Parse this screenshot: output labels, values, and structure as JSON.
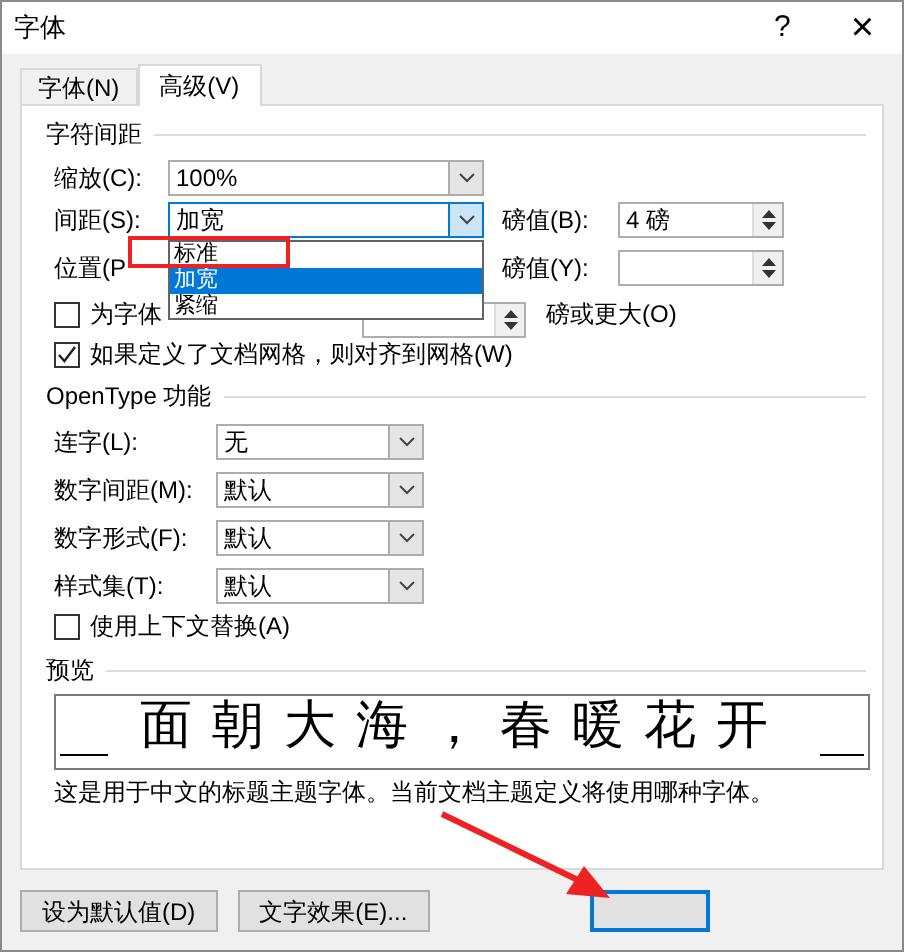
{
  "window": {
    "title": "字体",
    "help": "?",
    "close": "×"
  },
  "tabs": [
    {
      "label": "字体(N)",
      "selected": false
    },
    {
      "label": "高级(V)",
      "selected": true
    }
  ],
  "character_spacing": {
    "heading": "字符间距",
    "scale": {
      "label": "缩放(C):",
      "value": "100%"
    },
    "spacing": {
      "label": "间距(S):",
      "value": "加宽",
      "open": true,
      "by_label": "磅值(B):",
      "by_value": "4 磅"
    },
    "spacing_options": [
      {
        "label": "标准",
        "selected": false
      },
      {
        "label": "加宽",
        "selected": true
      },
      {
        "label": "紧缩",
        "selected": false
      }
    ],
    "position": {
      "label": "位置(P",
      "by_label": "磅值(Y):"
    },
    "kerning": {
      "label": "为字体",
      "checked": false,
      "suffix": "磅或更大(O)"
    },
    "snap_to_grid": {
      "label": "如果定义了文档网格，则对齐到网格(W)",
      "checked": true
    }
  },
  "opentype": {
    "heading": "OpenType 功能",
    "rows": [
      {
        "label": "连字(L):",
        "value": "无"
      },
      {
        "label": "数字间距(M):",
        "value": "默认"
      },
      {
        "label": "数字形式(F):",
        "value": "默认"
      },
      {
        "label": "样式集(T):",
        "value": "默认"
      }
    ],
    "contextual": {
      "label": "使用上下文替换(A)",
      "checked": false
    }
  },
  "preview": {
    "heading": "预览",
    "sample": "面朝大海，春暖花开",
    "note": "这是用于中文的标题主题字体。当前文档主题定义将使用哪种字体。"
  },
  "buttons": [
    {
      "label": "设为默认值(D)"
    },
    {
      "label": "文字效果(E)..."
    }
  ]
}
